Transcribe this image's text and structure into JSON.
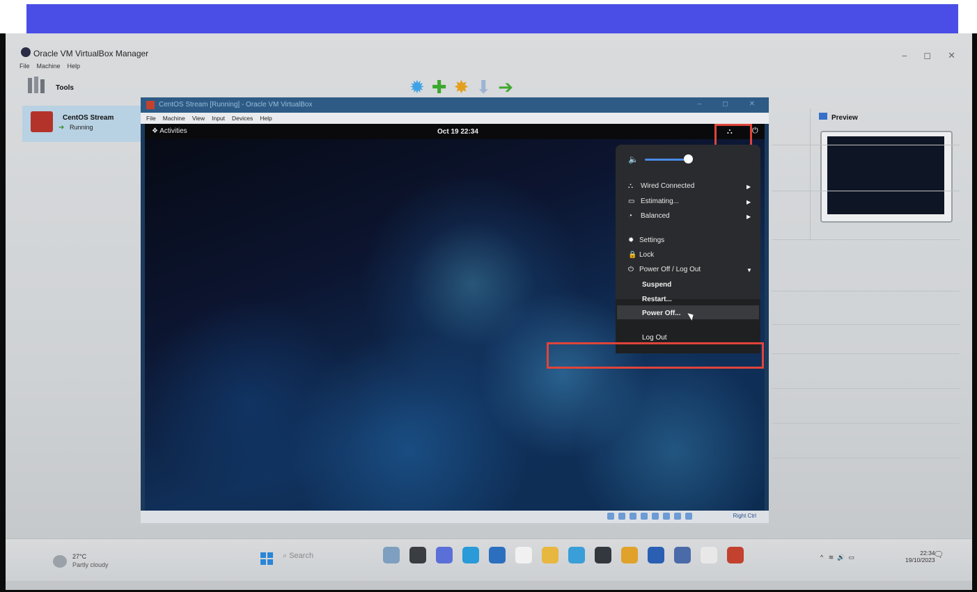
{
  "manager": {
    "title": "Oracle VM VirtualBox Manager",
    "menu": [
      "File",
      "Machine",
      "Help"
    ],
    "tools_label": "Tools",
    "vm_name": "CentOS Stream",
    "vm_state": "Running",
    "preview_label": "Preview"
  },
  "guest_window": {
    "title": "CentOS Stream [Running] - Oracle VM VirtualBox",
    "menu": [
      "File",
      "Machine",
      "View",
      "Input",
      "Devices",
      "Help"
    ],
    "status_hostkey": "Right Ctrl"
  },
  "gnome": {
    "activities": "Activities",
    "clock": "Oct 19  22:34",
    "menu": {
      "wired": "Wired Connected",
      "battery": "Estimating...",
      "power_mode": "Balanced",
      "settings": "Settings",
      "lock": "Lock",
      "power_off_logout": "Power Off / Log Out",
      "suspend": "Suspend",
      "restart": "Restart...",
      "power_off": "Power Off...",
      "log_out": "Log Out"
    }
  },
  "taskbar": {
    "weather_temp": "27°C",
    "weather_desc": "Partly cloudy",
    "search": "Search",
    "time": "22:34",
    "date": "19/10/2023"
  },
  "colors": {
    "highlight": "#e0443a",
    "banner": "#4a4ee6"
  }
}
